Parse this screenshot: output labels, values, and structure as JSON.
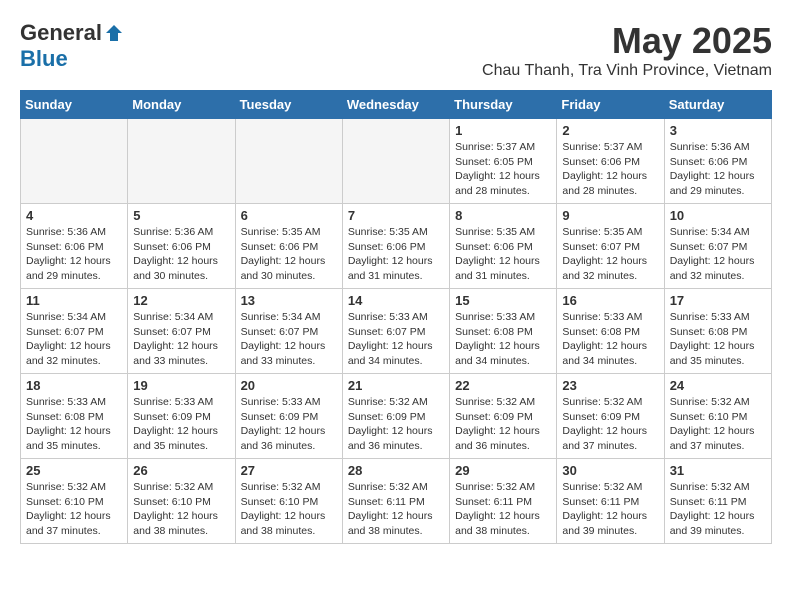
{
  "logo": {
    "general": "General",
    "blue": "Blue"
  },
  "title": {
    "month": "May 2025",
    "location": "Chau Thanh, Tra Vinh Province, Vietnam"
  },
  "headers": [
    "Sunday",
    "Monday",
    "Tuesday",
    "Wednesday",
    "Thursday",
    "Friday",
    "Saturday"
  ],
  "weeks": [
    [
      {
        "day": "",
        "info": ""
      },
      {
        "day": "",
        "info": ""
      },
      {
        "day": "",
        "info": ""
      },
      {
        "day": "",
        "info": ""
      },
      {
        "day": "1",
        "info": "Sunrise: 5:37 AM\nSunset: 6:05 PM\nDaylight: 12 hours\nand 28 minutes."
      },
      {
        "day": "2",
        "info": "Sunrise: 5:37 AM\nSunset: 6:06 PM\nDaylight: 12 hours\nand 28 minutes."
      },
      {
        "day": "3",
        "info": "Sunrise: 5:36 AM\nSunset: 6:06 PM\nDaylight: 12 hours\nand 29 minutes."
      }
    ],
    [
      {
        "day": "4",
        "info": "Sunrise: 5:36 AM\nSunset: 6:06 PM\nDaylight: 12 hours\nand 29 minutes."
      },
      {
        "day": "5",
        "info": "Sunrise: 5:36 AM\nSunset: 6:06 PM\nDaylight: 12 hours\nand 30 minutes."
      },
      {
        "day": "6",
        "info": "Sunrise: 5:35 AM\nSunset: 6:06 PM\nDaylight: 12 hours\nand 30 minutes."
      },
      {
        "day": "7",
        "info": "Sunrise: 5:35 AM\nSunset: 6:06 PM\nDaylight: 12 hours\nand 31 minutes."
      },
      {
        "day": "8",
        "info": "Sunrise: 5:35 AM\nSunset: 6:06 PM\nDaylight: 12 hours\nand 31 minutes."
      },
      {
        "day": "9",
        "info": "Sunrise: 5:35 AM\nSunset: 6:07 PM\nDaylight: 12 hours\nand 32 minutes."
      },
      {
        "day": "10",
        "info": "Sunrise: 5:34 AM\nSunset: 6:07 PM\nDaylight: 12 hours\nand 32 minutes."
      }
    ],
    [
      {
        "day": "11",
        "info": "Sunrise: 5:34 AM\nSunset: 6:07 PM\nDaylight: 12 hours\nand 32 minutes."
      },
      {
        "day": "12",
        "info": "Sunrise: 5:34 AM\nSunset: 6:07 PM\nDaylight: 12 hours\nand 33 minutes."
      },
      {
        "day": "13",
        "info": "Sunrise: 5:34 AM\nSunset: 6:07 PM\nDaylight: 12 hours\nand 33 minutes."
      },
      {
        "day": "14",
        "info": "Sunrise: 5:33 AM\nSunset: 6:07 PM\nDaylight: 12 hours\nand 34 minutes."
      },
      {
        "day": "15",
        "info": "Sunrise: 5:33 AM\nSunset: 6:08 PM\nDaylight: 12 hours\nand 34 minutes."
      },
      {
        "day": "16",
        "info": "Sunrise: 5:33 AM\nSunset: 6:08 PM\nDaylight: 12 hours\nand 34 minutes."
      },
      {
        "day": "17",
        "info": "Sunrise: 5:33 AM\nSunset: 6:08 PM\nDaylight: 12 hours\nand 35 minutes."
      }
    ],
    [
      {
        "day": "18",
        "info": "Sunrise: 5:33 AM\nSunset: 6:08 PM\nDaylight: 12 hours\nand 35 minutes."
      },
      {
        "day": "19",
        "info": "Sunrise: 5:33 AM\nSunset: 6:09 PM\nDaylight: 12 hours\nand 35 minutes."
      },
      {
        "day": "20",
        "info": "Sunrise: 5:33 AM\nSunset: 6:09 PM\nDaylight: 12 hours\nand 36 minutes."
      },
      {
        "day": "21",
        "info": "Sunrise: 5:32 AM\nSunset: 6:09 PM\nDaylight: 12 hours\nand 36 minutes."
      },
      {
        "day": "22",
        "info": "Sunrise: 5:32 AM\nSunset: 6:09 PM\nDaylight: 12 hours\nand 36 minutes."
      },
      {
        "day": "23",
        "info": "Sunrise: 5:32 AM\nSunset: 6:09 PM\nDaylight: 12 hours\nand 37 minutes."
      },
      {
        "day": "24",
        "info": "Sunrise: 5:32 AM\nSunset: 6:10 PM\nDaylight: 12 hours\nand 37 minutes."
      }
    ],
    [
      {
        "day": "25",
        "info": "Sunrise: 5:32 AM\nSunset: 6:10 PM\nDaylight: 12 hours\nand 37 minutes."
      },
      {
        "day": "26",
        "info": "Sunrise: 5:32 AM\nSunset: 6:10 PM\nDaylight: 12 hours\nand 38 minutes."
      },
      {
        "day": "27",
        "info": "Sunrise: 5:32 AM\nSunset: 6:10 PM\nDaylight: 12 hours\nand 38 minutes."
      },
      {
        "day": "28",
        "info": "Sunrise: 5:32 AM\nSunset: 6:11 PM\nDaylight: 12 hours\nand 38 minutes."
      },
      {
        "day": "29",
        "info": "Sunrise: 5:32 AM\nSunset: 6:11 PM\nDaylight: 12 hours\nand 38 minutes."
      },
      {
        "day": "30",
        "info": "Sunrise: 5:32 AM\nSunset: 6:11 PM\nDaylight: 12 hours\nand 39 minutes."
      },
      {
        "day": "31",
        "info": "Sunrise: 5:32 AM\nSunset: 6:11 PM\nDaylight: 12 hours\nand 39 minutes."
      }
    ]
  ]
}
